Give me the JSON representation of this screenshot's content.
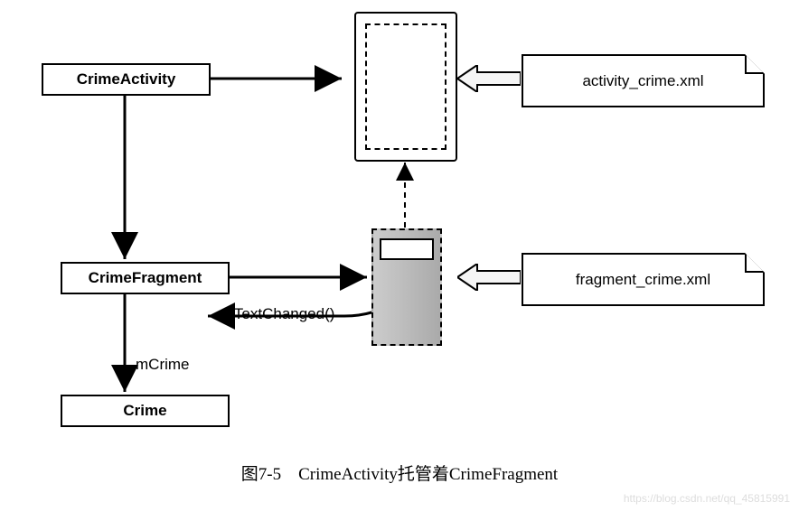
{
  "boxes": {
    "crimeActivity": "CrimeActivity",
    "crimeFragment": "CrimeFragment",
    "crime": "Crime"
  },
  "files": {
    "activityXml": "activity_crime.xml",
    "fragmentXml": "fragment_crime.xml"
  },
  "labels": {
    "onTextChanged": "onTextChanged()",
    "mCrime": "mCrime"
  },
  "caption": "图7-5　CrimeActivity托管着CrimeFragment",
  "watermark": "https://blog.csdn.net/qq_45815991"
}
